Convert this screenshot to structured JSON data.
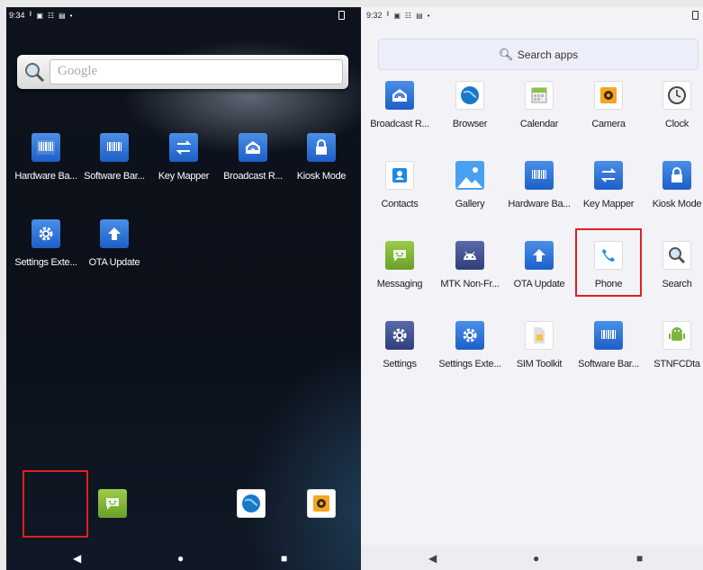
{
  "home": {
    "status": {
      "time": "9:34",
      "icons": [
        "upload-icon",
        "photo-icon",
        "signal-icon",
        "sdcard-icon",
        "dot-icon"
      ]
    },
    "google_search": {
      "placeholder": "Google"
    },
    "apps": [
      {
        "label": "Hardware Ba...",
        "icon": "barcode-icon"
      },
      {
        "label": "Software Bar...",
        "icon": "barcode-icon"
      },
      {
        "label": "Key Mapper",
        "icon": "swap-arrows-icon"
      },
      {
        "label": "Broadcast R...",
        "icon": "broadcast-icon"
      },
      {
        "label": "Kiosk Mode",
        "icon": "lock-icon"
      },
      {
        "label": "Settings Exte...",
        "icon": "gear-icon"
      },
      {
        "label": "OTA Update",
        "icon": "up-arrow-icon"
      }
    ],
    "dock": [
      "messaging-icon",
      "browser-icon",
      "camera-icon"
    ]
  },
  "drawer": {
    "status": {
      "time": "9:32",
      "icons": [
        "upload-icon",
        "photo-icon",
        "signal-icon",
        "sdcard-icon",
        "dot-icon"
      ]
    },
    "search": {
      "label": "Search apps"
    },
    "apps": [
      {
        "label": "Broadcast R...",
        "icon": "broadcast-icon"
      },
      {
        "label": "Browser",
        "icon": "browser-icon"
      },
      {
        "label": "Calendar",
        "icon": "calendar-icon"
      },
      {
        "label": "Camera",
        "icon": "camera-icon"
      },
      {
        "label": "Clock",
        "icon": "clock-icon"
      },
      {
        "label": "Contacts",
        "icon": "contacts-icon"
      },
      {
        "label": "Gallery",
        "icon": "gallery-icon"
      },
      {
        "label": "Hardware Ba...",
        "icon": "barcode-icon"
      },
      {
        "label": "Key Mapper",
        "icon": "swap-arrows-icon"
      },
      {
        "label": "Kiosk Mode",
        "icon": "lock-icon"
      },
      {
        "label": "Messaging",
        "icon": "messaging-icon"
      },
      {
        "label": "MTK Non-Fr...",
        "icon": "android-icon"
      },
      {
        "label": "OTA Update",
        "icon": "up-arrow-icon"
      },
      {
        "label": "Phone",
        "icon": "phone-icon"
      },
      {
        "label": "Search",
        "icon": "search-icon"
      },
      {
        "label": "Settings",
        "icon": "gear-icon"
      },
      {
        "label": "Settings Exte...",
        "icon": "gear-icon"
      },
      {
        "label": "SIM Toolkit",
        "icon": "sim-icon"
      },
      {
        "label": "Software Bar...",
        "icon": "barcode-icon"
      },
      {
        "label": "STNFCDta",
        "icon": "android-green-icon"
      }
    ]
  },
  "colors": {
    "highlight": "#e02020",
    "accent_blue": "#1d5fc8"
  }
}
